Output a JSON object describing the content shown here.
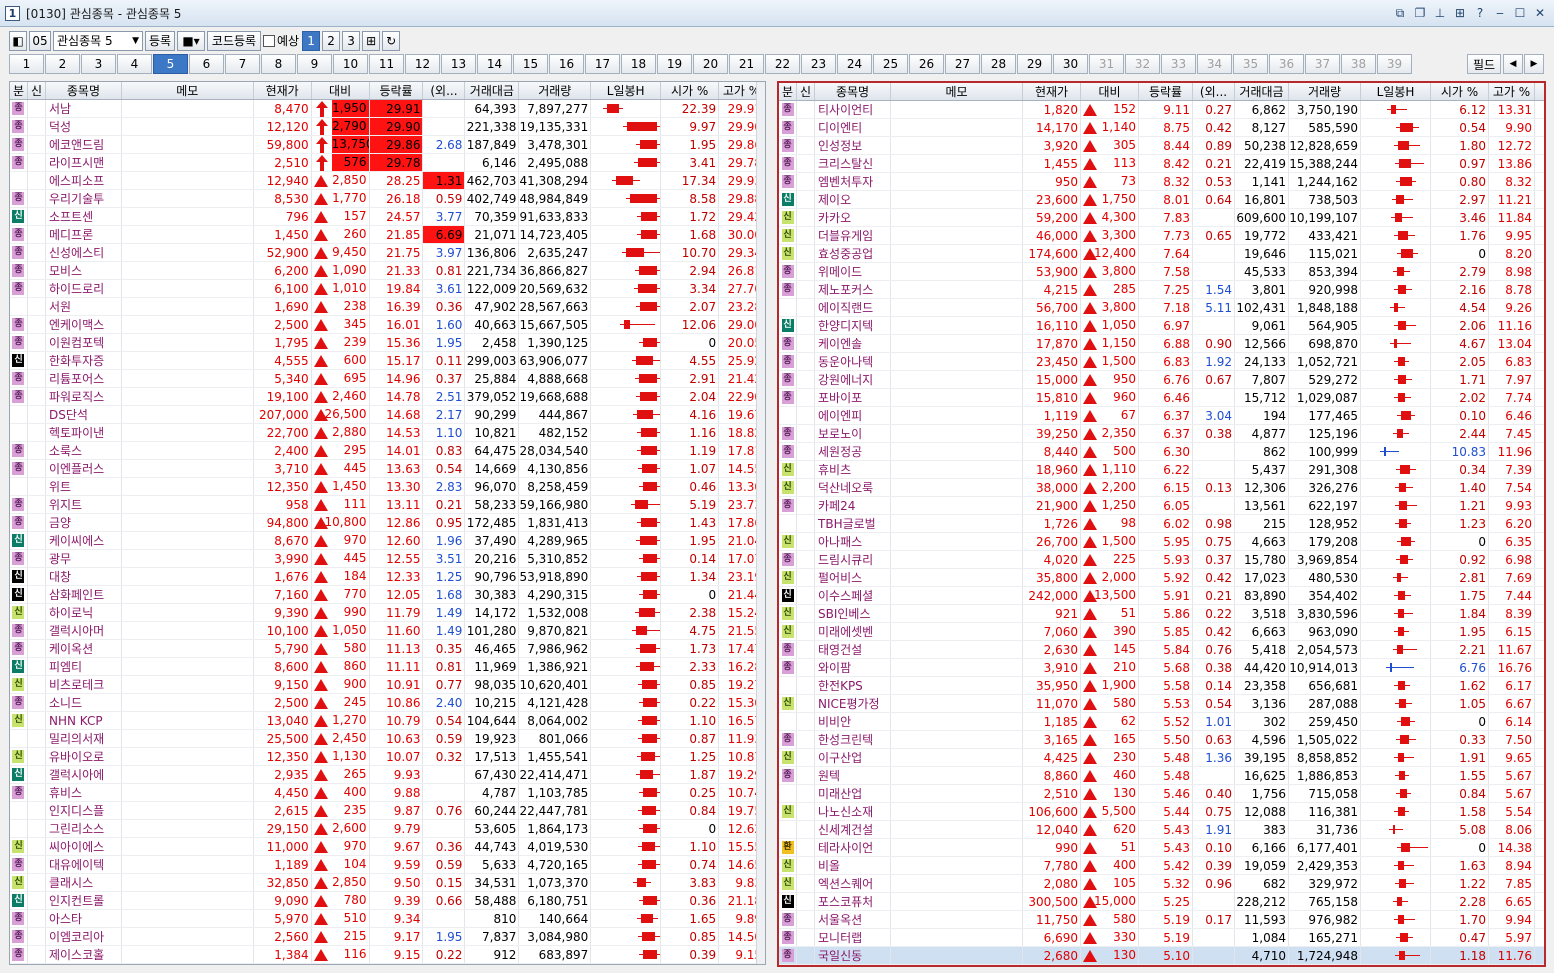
{
  "window": {
    "title": "[0130] 관심종목 - 관심종목 5",
    "app_icon": "1"
  },
  "toolbar": {
    "group_no": "05",
    "group_name": "관심종목 5",
    "register": "등록",
    "code_register": "코드등록",
    "forecast": "예상",
    "pages": [
      "1",
      "2",
      "3"
    ]
  },
  "tabs": {
    "items": [
      "1",
      "2",
      "3",
      "4",
      "5",
      "6",
      "7",
      "8",
      "9",
      "10",
      "11",
      "12",
      "13",
      "14",
      "15",
      "16",
      "17",
      "18",
      "19",
      "20",
      "21",
      "22",
      "23",
      "24",
      "25",
      "26",
      "27",
      "28",
      "29",
      "30",
      "31",
      "32",
      "33",
      "34",
      "35",
      "36",
      "37",
      "38",
      "39"
    ],
    "active": "5",
    "field": "필드"
  },
  "columns": [
    "분",
    "신",
    "종목명",
    "메모",
    "현재가",
    "대비",
    "등락률",
    "(외...",
    "거래대금",
    "거래량",
    "L일봉H",
    "시가 %",
    "고가 %"
  ],
  "colors": {
    "up": "#e00000",
    "down": "#1f4fd0",
    "highlight_red": "#ff1212",
    "frame_red": "#b8292e"
  },
  "left_rows": [
    [
      "m",
      "",
      "서남",
      "8,470",
      "a",
      "1,950",
      "29.91",
      "",
      "64,393",
      "7,897,277",
      "22.39",
      "29.91",
      1,
      1,
      0
    ],
    [
      "m",
      "",
      "덕성",
      "12,120",
      "a",
      "2,790",
      "29.90",
      "",
      "221,338",
      "19,135,331",
      "9.97",
      "29.90",
      1,
      1,
      0
    ],
    [
      "m",
      "",
      "에코앤드림",
      "59,800",
      "a",
      "13,750",
      "29.86",
      "2.68",
      "187,849",
      "3,478,301",
      "1.95",
      "29.86",
      1,
      1,
      0
    ],
    [
      "m",
      "",
      "라이프시맨",
      "2,510",
      "a",
      "576",
      "29.78",
      "",
      "6,146",
      "2,495,088",
      "3.41",
      "29.78",
      1,
      1,
      0
    ],
    [
      "",
      "",
      "에스피소프",
      "12,940",
      "t",
      "2,850",
      "28.25",
      "1.31",
      "462,703",
      "41,308,294",
      "17.34",
      "29.93",
      0,
      0,
      1
    ],
    [
      "m",
      "",
      "우리기술투",
      "8,530",
      "t",
      "1,770",
      "26.18",
      "0.59",
      "402,749",
      "48,984,849",
      "8.58",
      "29.88",
      0,
      0,
      0
    ],
    [
      "s",
      "",
      "소프트센",
      "796",
      "t",
      "157",
      "24.57",
      "3.77",
      "70,359",
      "91,633,833",
      "1.72",
      "29.42",
      0,
      0,
      0
    ],
    [
      "m",
      "",
      "메디프론",
      "1,450",
      "t",
      "260",
      "21.85",
      "6.69",
      "21,071",
      "14,723,405",
      "1.68",
      "30.00",
      0,
      0,
      1
    ],
    [
      "m",
      "",
      "신성에스티",
      "52,900",
      "t",
      "9,450",
      "21.75",
      "3.97",
      "136,806",
      "2,635,247",
      "10.70",
      "29.34",
      0,
      0,
      0
    ],
    [
      "m",
      "",
      "모비스",
      "6,200",
      "t",
      "1,090",
      "21.33",
      "0.81",
      "221,734",
      "36,866,827",
      "2.94",
      "26.81",
      0,
      0,
      0
    ],
    [
      "m",
      "",
      "하이드로리",
      "6,100",
      "t",
      "1,010",
      "19.84",
      "3.61",
      "122,009",
      "20,569,632",
      "3.34",
      "27.70",
      0,
      0,
      0
    ],
    [
      "",
      "",
      "서원",
      "1,690",
      "t",
      "238",
      "16.39",
      "0.36",
      "47,902",
      "28,567,663",
      "2.07",
      "23.28",
      0,
      0,
      0
    ],
    [
      "m",
      "",
      "엔케이맥스",
      "2,500",
      "t",
      "345",
      "16.01",
      "1.60",
      "40,663",
      "15,667,505",
      "12.06",
      "29.00",
      0,
      0,
      0
    ],
    [
      "m",
      "",
      "이원컴포텍",
      "1,795",
      "t",
      "239",
      "15.36",
      "1.95",
      "2,458",
      "1,390,125",
      "0",
      "20.05",
      0,
      0,
      0
    ],
    [
      "k",
      "",
      "한화투자증",
      "4,555",
      "t",
      "600",
      "15.17",
      "0.11",
      "299,003",
      "63,906,077",
      "4.55",
      "25.92",
      0,
      0,
      0
    ],
    [
      "m",
      "",
      "리튬포어스",
      "5,340",
      "t",
      "695",
      "14.96",
      "0.37",
      "25,884",
      "4,888,668",
      "2.91",
      "21.42",
      0,
      0,
      0
    ],
    [
      "m",
      "",
      "파워로직스",
      "19,100",
      "t",
      "2,460",
      "14.78",
      "2.51",
      "379,052",
      "19,668,688",
      "2.04",
      "22.90",
      0,
      0,
      0
    ],
    [
      "",
      "",
      "DS단석",
      "207,000",
      "t",
      "26,500",
      "14.68",
      "2.17",
      "90,299",
      "444,867",
      "4.16",
      "19.67",
      0,
      0,
      0
    ],
    [
      "",
      "",
      "헥토파이낸",
      "22,700",
      "t",
      "2,880",
      "14.53",
      "1.10",
      "10,821",
      "482,152",
      "1.16",
      "18.82",
      0,
      0,
      0
    ],
    [
      "m",
      "",
      "소룩스",
      "2,400",
      "t",
      "295",
      "14.01",
      "0.83",
      "64,475",
      "28,034,540",
      "1.19",
      "17.81",
      0,
      0,
      0
    ],
    [
      "m",
      "",
      "이엔플러스",
      "3,710",
      "t",
      "445",
      "13.63",
      "0.54",
      "14,669",
      "4,130,856",
      "1.07",
      "14.55",
      0,
      0,
      0
    ],
    [
      "",
      "",
      "위트",
      "12,350",
      "t",
      "1,450",
      "13.30",
      "2.83",
      "96,070",
      "8,258,459",
      "0.46",
      "13.30",
      0,
      0,
      0
    ],
    [
      "m",
      "",
      "위지트",
      "958",
      "t",
      "111",
      "13.11",
      "0.21",
      "58,233",
      "59,166,980",
      "5.19",
      "23.73",
      0,
      0,
      0
    ],
    [
      "m",
      "",
      "금양",
      "94,800",
      "t",
      "10,800",
      "12.86",
      "0.95",
      "172,485",
      "1,831,413",
      "1.43",
      "17.86",
      0,
      0,
      0
    ],
    [
      "s",
      "",
      "케이씨에스",
      "8,670",
      "t",
      "970",
      "12.60",
      "1.96",
      "37,490",
      "4,289,965",
      "1.95",
      "21.04",
      0,
      0,
      0
    ],
    [
      "m",
      "",
      "광무",
      "3,990",
      "t",
      "445",
      "12.55",
      "3.51",
      "20,216",
      "5,310,852",
      "0.14",
      "17.07",
      0,
      0,
      0
    ],
    [
      "k",
      "",
      "대창",
      "1,676",
      "t",
      "184",
      "12.33",
      "1.25",
      "90,796",
      "53,918,890",
      "1.34",
      "23.19",
      0,
      0,
      0
    ],
    [
      "k",
      "",
      "삼화페인트",
      "7,160",
      "t",
      "770",
      "12.05",
      "1.68",
      "30,383",
      "4,290,315",
      "0",
      "21.44",
      0,
      0,
      0
    ],
    [
      "c",
      "",
      "하이로닉",
      "9,390",
      "t",
      "990",
      "11.79",
      "1.49",
      "14,172",
      "1,532,008",
      "2.38",
      "15.24",
      0,
      0,
      0
    ],
    [
      "m",
      "",
      "갤럭시아머",
      "10,100",
      "t",
      "1,050",
      "11.60",
      "1.49",
      "101,280",
      "9,870,821",
      "4.75",
      "21.55",
      0,
      0,
      0
    ],
    [
      "m",
      "",
      "케이옥션",
      "5,790",
      "t",
      "580",
      "11.13",
      "0.35",
      "46,465",
      "7,986,962",
      "1.73",
      "17.47",
      0,
      0,
      0
    ],
    [
      "s",
      "",
      "피엠티",
      "8,600",
      "t",
      "860",
      "11.11",
      "0.81",
      "11,969",
      "1,386,921",
      "2.33",
      "16.28",
      0,
      0,
      0
    ],
    [
      "c",
      "",
      "비츠로테크",
      "9,150",
      "t",
      "900",
      "10.91",
      "0.77",
      "98,035",
      "10,620,401",
      "0.85",
      "19.27",
      0,
      0,
      0
    ],
    [
      "m",
      "",
      "소니드",
      "2,500",
      "t",
      "245",
      "10.86",
      "2.40",
      "10,215",
      "4,121,428",
      "0.22",
      "15.30",
      0,
      0,
      0
    ],
    [
      "c",
      "",
      "NHN KCP",
      "13,040",
      "t",
      "1,270",
      "10.79",
      "0.54",
      "104,644",
      "8,064,002",
      "1.10",
      "16.57",
      0,
      0,
      0
    ],
    [
      "",
      "",
      "밀리의서재",
      "25,500",
      "t",
      "2,450",
      "10.63",
      "0.59",
      "19,923",
      "801,066",
      "0.87",
      "11.93",
      0,
      0,
      0
    ],
    [
      "c",
      "",
      "유바이오로",
      "12,350",
      "t",
      "1,130",
      "10.07",
      "0.32",
      "17,513",
      "1,455,541",
      "1.25",
      "10.87",
      0,
      0,
      0
    ],
    [
      "s",
      "",
      "갤럭시아에",
      "2,935",
      "t",
      "265",
      "9.93",
      "",
      "67,430",
      "22,414,471",
      "1.87",
      "19.29",
      0,
      0,
      0
    ],
    [
      "m",
      "",
      "휴비스",
      "4,450",
      "t",
      "400",
      "9.88",
      "",
      "4,787",
      "1,103,785",
      "0.25",
      "10.74",
      0,
      0,
      0
    ],
    [
      "",
      "",
      "인지디스플",
      "2,615",
      "t",
      "235",
      "9.87",
      "0.76",
      "60,244",
      "22,447,781",
      "0.84",
      "19.75",
      0,
      0,
      0
    ],
    [
      "",
      "",
      "그린리소스",
      "29,150",
      "t",
      "2,600",
      "9.79",
      "",
      "53,605",
      "1,864,173",
      "0",
      "12.62",
      0,
      0,
      0
    ],
    [
      "c",
      "",
      "씨아이에스",
      "11,000",
      "t",
      "970",
      "9.67",
      "0.36",
      "44,743",
      "4,019,530",
      "1.10",
      "15.55",
      0,
      0,
      0
    ],
    [
      "m",
      "",
      "대유에이텍",
      "1,189",
      "t",
      "104",
      "9.59",
      "0.59",
      "5,633",
      "4,720,165",
      "0.74",
      "14.65",
      0,
      0,
      0
    ],
    [
      "c",
      "",
      "클래시스",
      "32,850",
      "t",
      "2,850",
      "9.50",
      "0.15",
      "34,531",
      "1,073,370",
      "3.83",
      "9.83",
      0,
      0,
      0
    ],
    [
      "s",
      "",
      "인지컨트롤",
      "9,090",
      "t",
      "780",
      "9.39",
      "0.66",
      "58,488",
      "6,180,751",
      "0.36",
      "21.18",
      0,
      0,
      0
    ],
    [
      "m",
      "",
      "아스타",
      "5,970",
      "t",
      "510",
      "9.34",
      "",
      "810",
      "140,664",
      "1.65",
      "9.89",
      0,
      0,
      0
    ],
    [
      "m",
      "",
      "이엠코리아",
      "2,560",
      "t",
      "215",
      "9.17",
      "1.95",
      "7,837",
      "3,084,980",
      "0.85",
      "14.50",
      0,
      0,
      0
    ],
    [
      "m",
      "",
      "제이스코홀",
      "1,384",
      "t",
      "116",
      "9.15",
      "0.22",
      "912",
      "683,897",
      "0.39",
      "9.15",
      0,
      0,
      0
    ]
  ],
  "right_rows": [
    [
      "m",
      "",
      "티사이언티",
      "1,820",
      "t",
      "152",
      "9.11",
      "0.27",
      "6,862",
      "3,750,190",
      "6.12",
      "13.31",
      0
    ],
    [
      "m",
      "",
      "디이엔티",
      "14,170",
      "t",
      "1,140",
      "8.75",
      "0.42",
      "8,127",
      "585,590",
      "0.54",
      "9.90",
      0
    ],
    [
      "m",
      "",
      "인성정보",
      "3,920",
      "t",
      "305",
      "8.44",
      "0.89",
      "50,238",
      "12,828,659",
      "1.80",
      "12.72",
      0
    ],
    [
      "m",
      "",
      "크리스탈신",
      "1,455",
      "t",
      "113",
      "8.42",
      "0.21",
      "22,419",
      "15,388,244",
      "0.97",
      "13.86",
      0
    ],
    [
      "m",
      "",
      "엠벤처투자",
      "950",
      "t",
      "73",
      "8.32",
      "0.53",
      "1,141",
      "1,244,162",
      "0.80",
      "8.32",
      0
    ],
    [
      "s",
      "",
      "제이오",
      "23,600",
      "t",
      "1,750",
      "8.01",
      "0.64",
      "16,801",
      "738,503",
      "2.97",
      "11.21",
      0
    ],
    [
      "c",
      "",
      "카카오",
      "59,200",
      "t",
      "4,300",
      "7.83",
      "",
      "609,600",
      "10,199,107",
      "3.46",
      "11.84",
      0
    ],
    [
      "c",
      "",
      "더블유게임",
      "46,000",
      "t",
      "3,300",
      "7.73",
      "0.65",
      "19,772",
      "433,421",
      "1.76",
      "9.95",
      0
    ],
    [
      "c",
      "",
      "효성중공업",
      "174,600",
      "t",
      "12,400",
      "7.64",
      "",
      "19,646",
      "115,021",
      "0",
      "8.20",
      0
    ],
    [
      "m",
      "",
      "위메이드",
      "53,900",
      "t",
      "3,800",
      "7.58",
      "",
      "45,533",
      "853,394",
      "2.79",
      "8.98",
      0
    ],
    [
      "m",
      "",
      "제노포커스",
      "4,215",
      "t",
      "285",
      "7.25",
      "1.54",
      "3,801",
      "920,998",
      "2.16",
      "8.78",
      0
    ],
    [
      "",
      "",
      "에이직랜드",
      "56,700",
      "t",
      "3,800",
      "7.18",
      "5.11",
      "102,431",
      "1,848,188",
      "4.54",
      "9.26",
      0
    ],
    [
      "s",
      "",
      "한양디지텍",
      "16,110",
      "t",
      "1,050",
      "6.97",
      "",
      "9,061",
      "564,905",
      "2.06",
      "11.16",
      0
    ],
    [
      "m",
      "",
      "케이엔솔",
      "17,870",
      "t",
      "1,150",
      "6.88",
      "0.90",
      "12,566",
      "698,870",
      "4.67",
      "13.04",
      0
    ],
    [
      "m",
      "",
      "동운아나텍",
      "23,450",
      "t",
      "1,500",
      "6.83",
      "1.92",
      "24,133",
      "1,052,721",
      "2.05",
      "6.83",
      0
    ],
    [
      "m",
      "",
      "강원에너지",
      "15,000",
      "t",
      "950",
      "6.76",
      "0.67",
      "7,807",
      "529,272",
      "1.71",
      "7.97",
      0
    ],
    [
      "m",
      "",
      "포바이포",
      "15,810",
      "t",
      "960",
      "6.46",
      "",
      "15,712",
      "1,029,087",
      "2.02",
      "7.74",
      0
    ],
    [
      "",
      "",
      "에이엔피",
      "1,119",
      "t",
      "67",
      "6.37",
      "3.04",
      "194",
      "177,465",
      "0.10",
      "6.46",
      0
    ],
    [
      "m",
      "",
      "보로노이",
      "39,250",
      "t",
      "2,350",
      "6.37",
      "0.38",
      "4,877",
      "125,196",
      "2.44",
      "7.45",
      0
    ],
    [
      "m",
      "",
      "세원정공",
      "8,440",
      "t",
      "500",
      "6.30",
      "",
      "862",
      "100,999",
      "10.83",
      "11.96",
      0
    ],
    [
      "c",
      "",
      "휴비츠",
      "18,960",
      "t",
      "1,110",
      "6.22",
      "",
      "5,437",
      "291,308",
      "0.34",
      "7.39",
      0
    ],
    [
      "c",
      "",
      "덕산네오룩",
      "38,000",
      "t",
      "2,200",
      "6.15",
      "0.13",
      "12,306",
      "326,276",
      "1.40",
      "7.54",
      0
    ],
    [
      "m",
      "",
      "카페24",
      "21,900",
      "t",
      "1,250",
      "6.05",
      "",
      "13,561",
      "622,197",
      "1.21",
      "9.93",
      0
    ],
    [
      "",
      "",
      "TBH글로벌",
      "1,726",
      "t",
      "98",
      "6.02",
      "0.98",
      "215",
      "128,952",
      "1.23",
      "6.20",
      0
    ],
    [
      "c",
      "",
      "아나패스",
      "26,700",
      "t",
      "1,500",
      "5.95",
      "0.75",
      "4,663",
      "179,208",
      "0",
      "6.35",
      0
    ],
    [
      "m",
      "",
      "드림시큐리",
      "4,020",
      "t",
      "225",
      "5.93",
      "0.37",
      "15,780",
      "3,969,854",
      "0.92",
      "6.98",
      0
    ],
    [
      "c",
      "",
      "펄어비스",
      "35,800",
      "t",
      "2,000",
      "5.92",
      "0.42",
      "17,023",
      "480,530",
      "2.81",
      "7.69",
      0
    ],
    [
      "k",
      "",
      "이수스페셜",
      "242,000",
      "t",
      "13,500",
      "5.91",
      "0.21",
      "83,890",
      "354,402",
      "1.75",
      "7.44",
      0
    ],
    [
      "c",
      "",
      "SBI인베스",
      "921",
      "t",
      "51",
      "5.86",
      "0.22",
      "3,518",
      "3,830,596",
      "1.84",
      "8.39",
      0
    ],
    [
      "c",
      "",
      "미래에셋벤",
      "7,060",
      "t",
      "390",
      "5.85",
      "0.42",
      "6,663",
      "963,090",
      "1.95",
      "6.15",
      0
    ],
    [
      "m",
      "",
      "태영건설",
      "2,630",
      "t",
      "145",
      "5.84",
      "0.76",
      "5,418",
      "2,054,573",
      "2.21",
      "11.67",
      0
    ],
    [
      "m",
      "",
      "와이팜",
      "3,910",
      "t",
      "210",
      "5.68",
      "0.38",
      "44,420",
      "10,914,013",
      "6.76",
      "16.76",
      0
    ],
    [
      "",
      "",
      "한전KPS",
      "35,950",
      "t",
      "1,900",
      "5.58",
      "0.14",
      "23,358",
      "656,681",
      "1.62",
      "6.17",
      0
    ],
    [
      "c",
      "",
      "NICE평가정",
      "11,070",
      "t",
      "580",
      "5.53",
      "0.54",
      "3,136",
      "287,088",
      "1.05",
      "6.67",
      0
    ],
    [
      "",
      "",
      "비비안",
      "1,185",
      "t",
      "62",
      "5.52",
      "1.01",
      "302",
      "259,450",
      "0",
      "6.14",
      0
    ],
    [
      "m",
      "",
      "한성크린텍",
      "3,165",
      "t",
      "165",
      "5.50",
      "0.63",
      "4,596",
      "1,505,022",
      "0.33",
      "7.50",
      0
    ],
    [
      "c",
      "",
      "이구산업",
      "4,425",
      "t",
      "230",
      "5.48",
      "1.36",
      "39,195",
      "8,858,852",
      "1.91",
      "9.65",
      0
    ],
    [
      "m",
      "",
      "원텍",
      "8,860",
      "t",
      "460",
      "5.48",
      "",
      "16,625",
      "1,886,853",
      "1.55",
      "5.67",
      0
    ],
    [
      "",
      "",
      "미래산업",
      "2,510",
      "t",
      "130",
      "5.46",
      "0.40",
      "1,756",
      "715,058",
      "0.84",
      "5.67",
      0
    ],
    [
      "c",
      "",
      "나노신소재",
      "106,600",
      "t",
      "5,500",
      "5.44",
      "0.75",
      "12,088",
      "116,381",
      "1.58",
      "5.54",
      0
    ],
    [
      "",
      "",
      "신세계건설",
      "12,040",
      "t",
      "620",
      "5.43",
      "1.91",
      "383",
      "31,736",
      "5.08",
      "8.06",
      0
    ],
    [
      "w",
      "",
      "테라사이언",
      "990",
      "t",
      "51",
      "5.43",
      "0.10",
      "6,166",
      "6,177,401",
      "0",
      "14.38",
      0
    ],
    [
      "c",
      "",
      "비올",
      "7,780",
      "t",
      "400",
      "5.42",
      "0.39",
      "19,059",
      "2,429,353",
      "1.63",
      "8.94",
      0
    ],
    [
      "c",
      "",
      "엑션스퀘어",
      "2,080",
      "t",
      "105",
      "5.32",
      "0.96",
      "682",
      "329,972",
      "1.22",
      "7.85",
      0
    ],
    [
      "k",
      "",
      "포스코퓨처",
      "300,500",
      "t",
      "15,000",
      "5.25",
      "",
      "228,212",
      "765,158",
      "2.28",
      "6.65",
      0
    ],
    [
      "m",
      "",
      "서울옥션",
      "11,750",
      "t",
      "580",
      "5.19",
      "0.17",
      "11,593",
      "976,982",
      "1.70",
      "9.94",
      0
    ],
    [
      "m",
      "",
      "모니터랩",
      "6,690",
      "t",
      "330",
      "5.19",
      "",
      "1,084",
      "165,271",
      "0.47",
      "5.97",
      0
    ],
    [
      "m",
      "",
      "국일신동",
      "2,680",
      "t",
      "130",
      "5.10",
      "",
      "4,710",
      "1,724,948",
      "1.18",
      "11.76",
      1
    ]
  ]
}
